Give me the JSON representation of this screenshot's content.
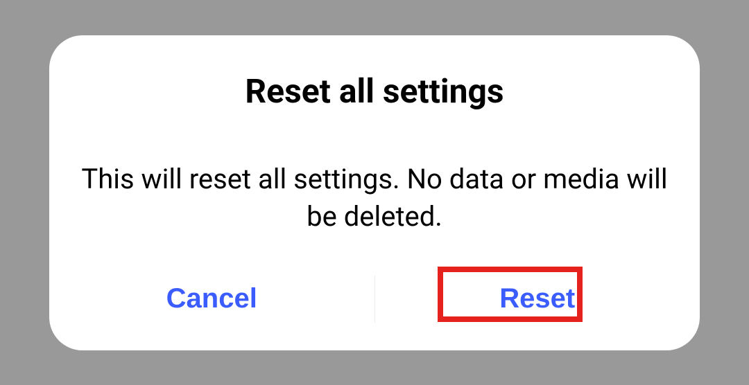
{
  "dialog": {
    "title": "Reset all settings",
    "body": "This will reset all settings. No data or media will be deleted.",
    "actions": {
      "cancel": "Cancel",
      "confirm": "Reset"
    }
  }
}
